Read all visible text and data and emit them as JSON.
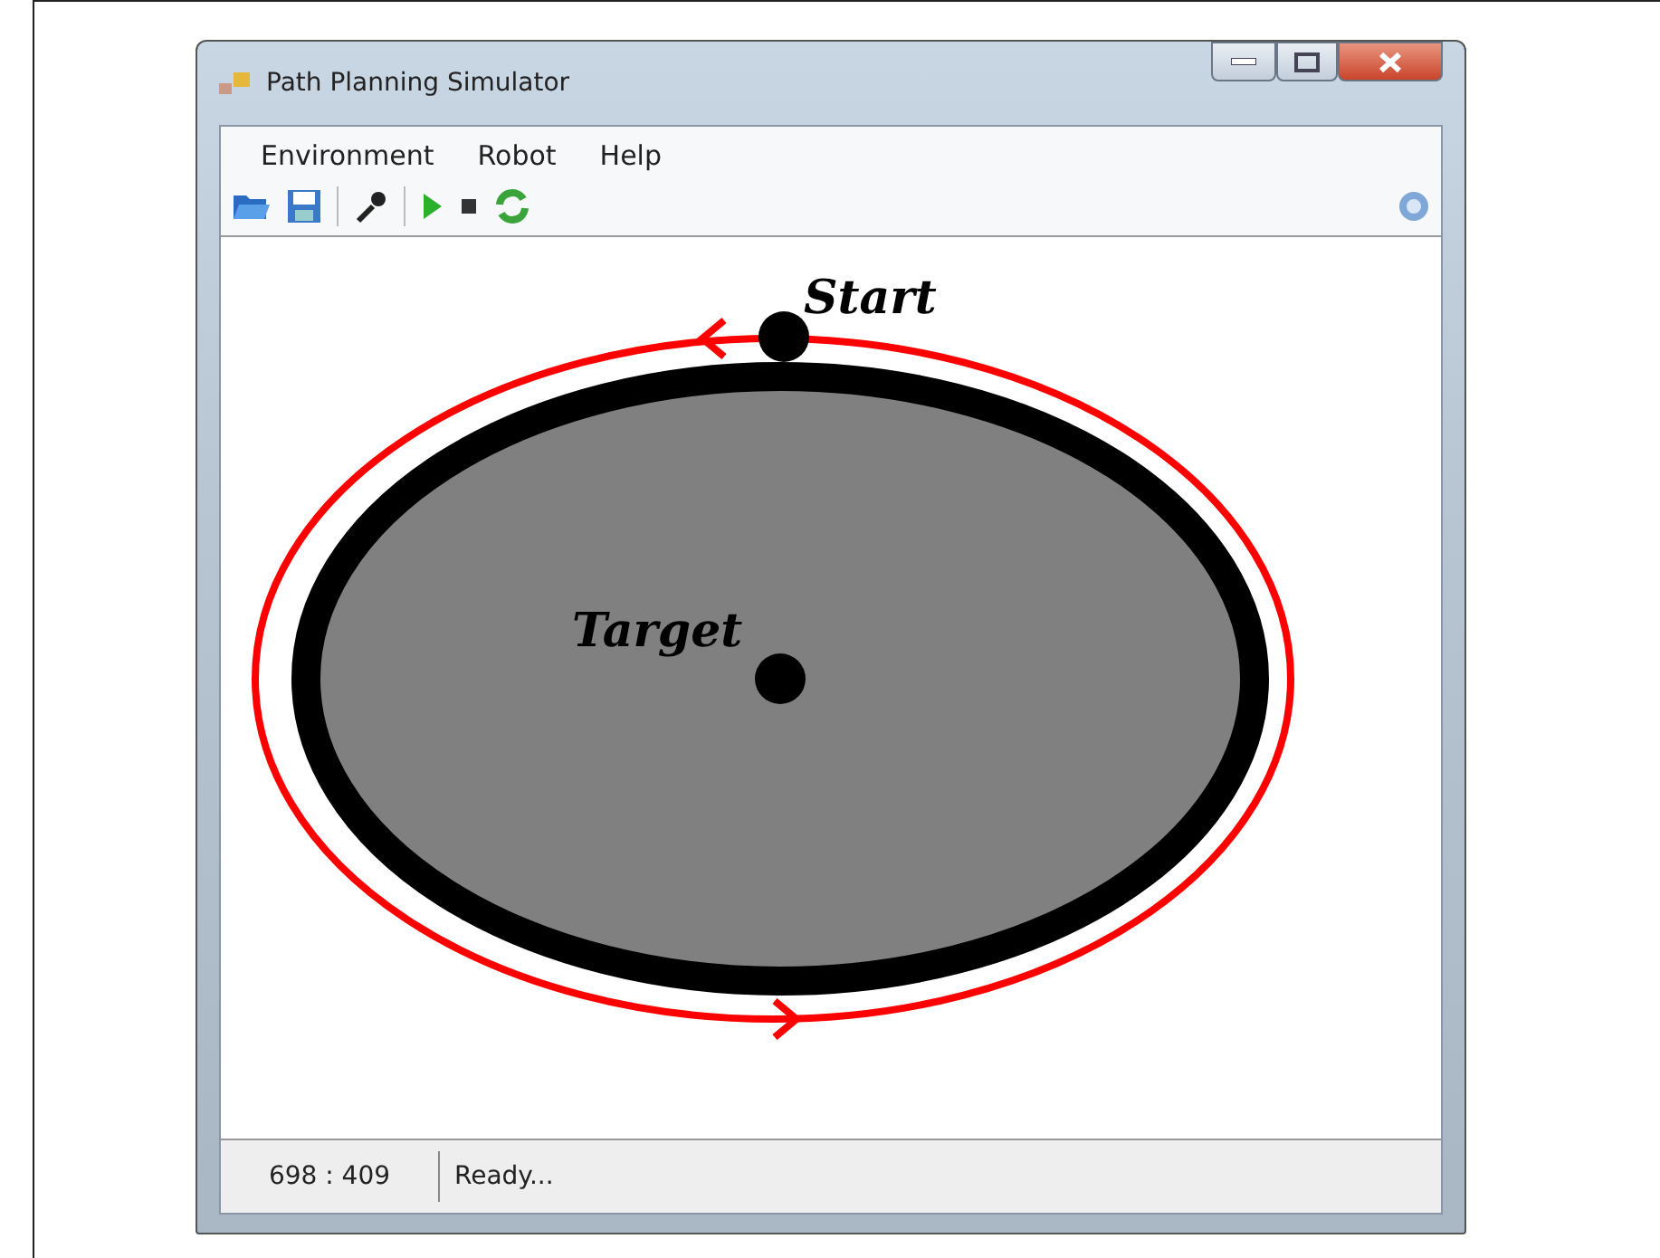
{
  "window": {
    "title": "Path Planning Simulator"
  },
  "menu": [
    {
      "label": "Environment"
    },
    {
      "label": "Robot"
    },
    {
      "label": "Help"
    }
  ],
  "canvas": {
    "labels": [
      {
        "kind": "start",
        "text": "Start"
      },
      {
        "kind": "target",
        "text": "Target"
      }
    ]
  },
  "status_bar": {
    "coordinates": "698 : 409",
    "message": "Ready..."
  }
}
